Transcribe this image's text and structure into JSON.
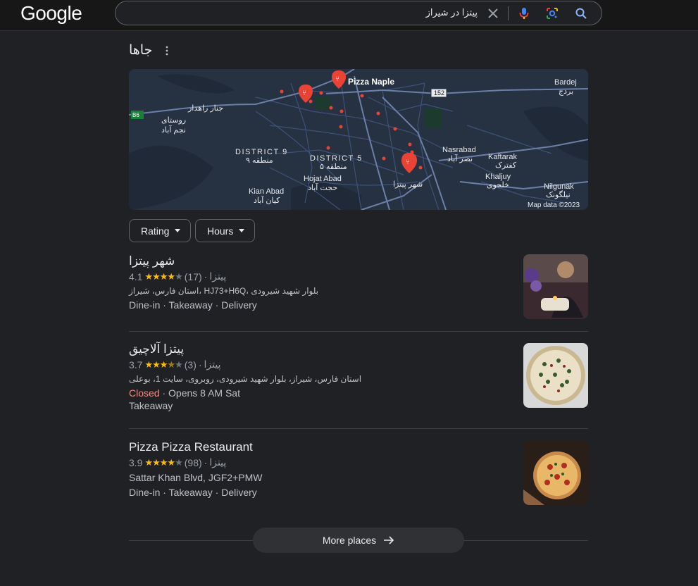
{
  "header": {
    "logo": "Google",
    "search_query": "پیتزا در شیراز"
  },
  "section": {
    "title": "جاها"
  },
  "map": {
    "labels": [
      {
        "text": "Pizza Naple"
      },
      {
        "text": "Bardej"
      },
      {
        "text": "بردج"
      },
      {
        "text": "152"
      },
      {
        "text": "B6"
      },
      {
        "text": "جنار راهدار"
      },
      {
        "text": "روستای"
      },
      {
        "text": "نجم آباد"
      },
      {
        "text": "DISTRICT 9"
      },
      {
        "text": "منطقه ۹"
      },
      {
        "text": "DISTRICT 5"
      },
      {
        "text": "منطقه ۵"
      },
      {
        "text": "Hojat Abad"
      },
      {
        "text": "حجت آباد"
      },
      {
        "text": "Kian Abad"
      },
      {
        "text": "کیان آباد"
      },
      {
        "text": "Nasrabad"
      },
      {
        "text": "نصر آباد"
      },
      {
        "text": "Kaftarak"
      },
      {
        "text": "کفترک"
      },
      {
        "text": "Khaljuy"
      },
      {
        "text": "خلجوی"
      },
      {
        "text": "Nilgunak"
      },
      {
        "text": "نیلگونک"
      },
      {
        "text": "شهر پیتزا"
      },
      {
        "text": "Map data ©2023"
      }
    ]
  },
  "filters": {
    "rating_label": "Rating",
    "hours_label": "Hours"
  },
  "places": [
    {
      "name": "شهر پیتزا",
      "rating": "4.1",
      "rating_value": 4.1,
      "reviews": "(17)",
      "category": "پیتزا",
      "address": "استان فارس، شیراز، HJ73+H6Q، بلوار شهید شیرودی",
      "status": "",
      "hours": "",
      "services": "Dine-in · Takeaway · Delivery"
    },
    {
      "name": "پیتزا آلاچیق",
      "rating": "3.7",
      "rating_value": 3.7,
      "reviews": "(3)",
      "category": "پیتزا",
      "address": "استان فارس، شیراز، بلوار شهید شیرودی، روبروی، سایت 1، بوعلی",
      "status": "Closed",
      "hours": "· Opens 8 AM Sat",
      "services": "Takeaway"
    },
    {
      "name": "Pizza Pizza Restaurant",
      "rating": "3.9",
      "rating_value": 3.9,
      "reviews": "(98)",
      "category": "پیتزا",
      "address": "Sattar Khan Blvd, JGF2+PMW",
      "status": "",
      "hours": "",
      "services": "Dine-in · Takeaway · Delivery"
    }
  ],
  "more": {
    "label": "More places"
  },
  "colors": {
    "background": "#202124",
    "star": "#fbbc04",
    "closed": "#f28b82",
    "pin": "#ea4335"
  }
}
